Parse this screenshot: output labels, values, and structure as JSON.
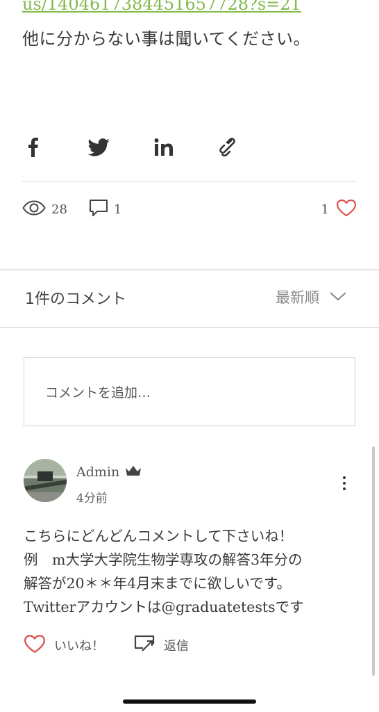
{
  "post": {
    "link_text": "us/1404617384451657728?s=21",
    "body_text": "他に分からない事は聞いてください。"
  },
  "share": {
    "icons": [
      "facebook-icon",
      "twitter-icon",
      "linkedin-icon",
      "link-icon"
    ]
  },
  "stats": {
    "views": "28",
    "comments": "1",
    "likes": "1"
  },
  "comments_section": {
    "count_label": "1件のコメント",
    "sort_label": "最新順",
    "input_placeholder": "コメントを追加…"
  },
  "comment": {
    "author": "Admin",
    "time": "4分前",
    "lines": [
      "こちらにどんどんコメントして下さいね！",
      "例　m大学大学院生物学専攻の解答3年分の",
      "解答が20＊＊年4月末までに欲しいです。",
      "Twitterアカウントは@graduatetestsです"
    ],
    "like_label": "いいね！",
    "reply_label": "返信"
  },
  "colors": {
    "link": "#7fba4a",
    "heart": "#d9534f",
    "text": "#3a3a3a"
  }
}
